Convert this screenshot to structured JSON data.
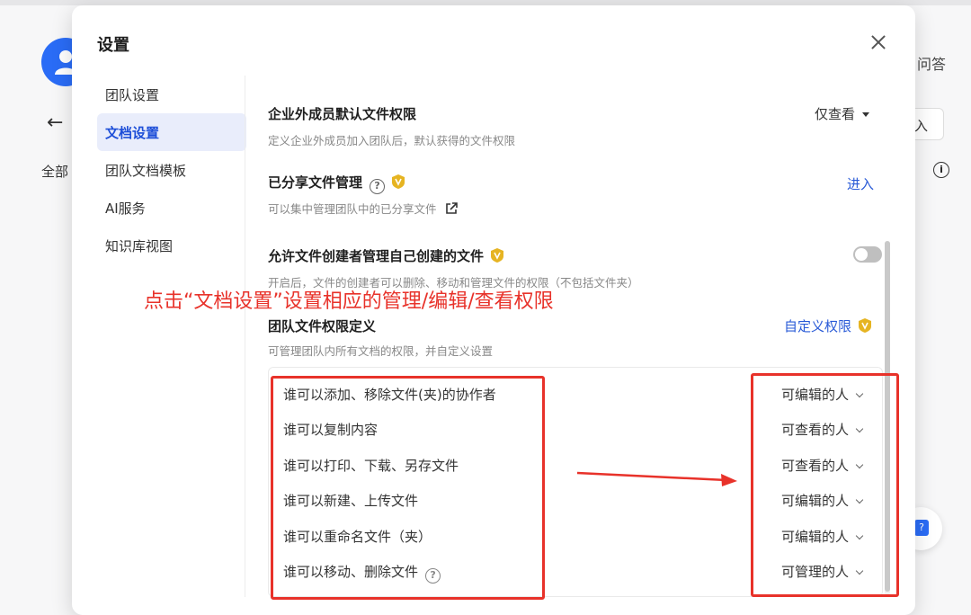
{
  "background": {
    "all_label": "全部",
    "right_text": "问答",
    "right_button": "入"
  },
  "modal": {
    "title": "设置",
    "close_label": "×"
  },
  "sidebar": {
    "items": [
      {
        "label": "团队设置",
        "active": false
      },
      {
        "label": "文档设置",
        "active": true
      },
      {
        "label": "团队文档模板",
        "active": false
      },
      {
        "label": "AI服务",
        "active": false
      },
      {
        "label": "知识库视图",
        "active": false
      }
    ]
  },
  "sections": {
    "external": {
      "title": "企业外成员默认文件权限",
      "desc": "定义企业外成员加入团队后，默认获得的文件权限",
      "value": "仅查看"
    },
    "shared": {
      "title": "已分享文件管理",
      "desc": "可以集中管理团队中的已分享文件",
      "link": "进入"
    },
    "creator": {
      "title": "允许文件创建者管理自己创建的文件",
      "desc": "开启后，文件的创建者可以删除、移动和管理文件的权限（不包括文件夹）",
      "enabled": false
    },
    "team_perm": {
      "title": "团队文件权限定义",
      "desc": "可管理团队内所有文档的权限，并自定义设置",
      "link": "自定义权限"
    }
  },
  "annotation": "点击“文档设置”设置相应的管理/编辑/查看权限",
  "permissions": [
    {
      "label": "谁可以添加、移除文件(夹)的协作者",
      "value": "可编辑的人"
    },
    {
      "label": "谁可以复制内容",
      "value": "可查看的人"
    },
    {
      "label": "谁可以打印、下载、另存文件",
      "value": "可查看的人"
    },
    {
      "label": "谁可以新建、上传文件",
      "value": "可编辑的人"
    },
    {
      "label": "谁可以重命名文件（夹）",
      "value": "可编辑的人"
    },
    {
      "label": "谁可以移动、删除文件",
      "value": "可管理的人",
      "help": true
    }
  ],
  "colors": {
    "accent": "#2a5bd7",
    "annotation_red": "#e8322a",
    "vip_gold": "#e6b422",
    "active_bg": "#e9edfb"
  }
}
